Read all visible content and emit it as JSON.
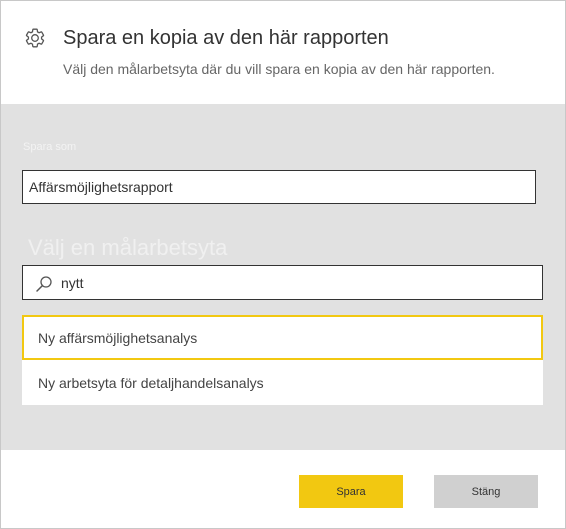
{
  "dialog": {
    "title": "Spara en kopia av den här rapporten",
    "subtitle": "Välj den målarbetsyta där du vill spara en kopia av den här rapporten.",
    "settings_icon": "gear-icon"
  },
  "form": {
    "save_as_label": "Spara som",
    "report_name_value": "Affärsmöjlighetsrapport",
    "workspace_label": "Välj en målarbetsyta",
    "search_value": "nytt",
    "search_icon": "search-icon"
  },
  "workspaces": [
    {
      "name": "Ny affärsmöjlighetsanalys",
      "selected": true
    },
    {
      "name": "Ny arbetsyta för detaljhandelsanalys",
      "selected": false
    }
  ],
  "buttons": {
    "save_label": "Spara",
    "close_label": "Stäng"
  },
  "colors": {
    "accent": "#f2c811",
    "panel_background": "#e1e1e1",
    "secondary_button": "#d0d0d0"
  }
}
